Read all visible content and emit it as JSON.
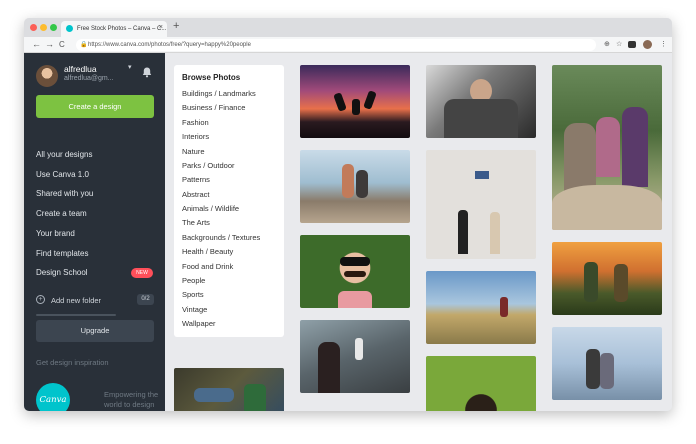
{
  "browser": {
    "tab_title": "Free Stock Photos – Canva – C...",
    "tab_close": "×",
    "new_tab": "+",
    "url": "https://www.canva.com/photos/free/?query=happy%20people",
    "lock": "🔒",
    "back": "←",
    "forward": "→",
    "reload": "C",
    "zoom": "⊕",
    "star": "☆",
    "menu": "⋮",
    "traffic_colors": [
      "#fc5f57",
      "#fdbc2e",
      "#33c748"
    ]
  },
  "sidebar": {
    "user_name": "alfredlua",
    "user_email": "alfredlua@gm...",
    "caret": "▾",
    "create_button": "Create a design",
    "nav": [
      {
        "label": "All your designs"
      },
      {
        "label": "Use Canva 1.0"
      },
      {
        "label": "Shared with you"
      },
      {
        "label": "Create a team"
      },
      {
        "label": "Your brand"
      },
      {
        "label": "Find templates"
      },
      {
        "label": "Design School"
      }
    ],
    "new_badge": "NEW",
    "add_folder_icon": "+",
    "add_folder": "Add new folder",
    "folder_count": "0/2",
    "upgrade": "Upgrade",
    "inspiration": "Get design inspiration",
    "logo_text": "Canva",
    "tagline": "Empowering the world to design",
    "accent_green": "#7dc241",
    "background": "#293039"
  },
  "browse": {
    "title": "Browse Photos",
    "categories": [
      "Buildings / Landmarks",
      "Business / Finance",
      "Fashion",
      "Interiors",
      "Nature",
      "Parks / Outdoor",
      "Patterns",
      "Abstract",
      "Animals / Wildlife",
      "The Arts",
      "Backgrounds / Textures",
      "Health / Beauty",
      "Food and Drink",
      "People",
      "Sports",
      "Vintage",
      "Wallpaper"
    ]
  },
  "photos": [
    {
      "name": "photo-jumping-sunset"
    },
    {
      "name": "photo-beach-friends"
    },
    {
      "name": "photo-fake-mustache"
    },
    {
      "name": "photo-railway-woman"
    },
    {
      "name": "photo-group-selfie"
    },
    {
      "name": "photo-couple-wall"
    },
    {
      "name": "photo-field-walk"
    },
    {
      "name": "photo-green-portrait"
    },
    {
      "name": "photo-family-rock"
    },
    {
      "name": "photo-kids-sunset"
    },
    {
      "name": "photo-couple-sea"
    },
    {
      "name": "photo-sofa-friends"
    }
  ]
}
